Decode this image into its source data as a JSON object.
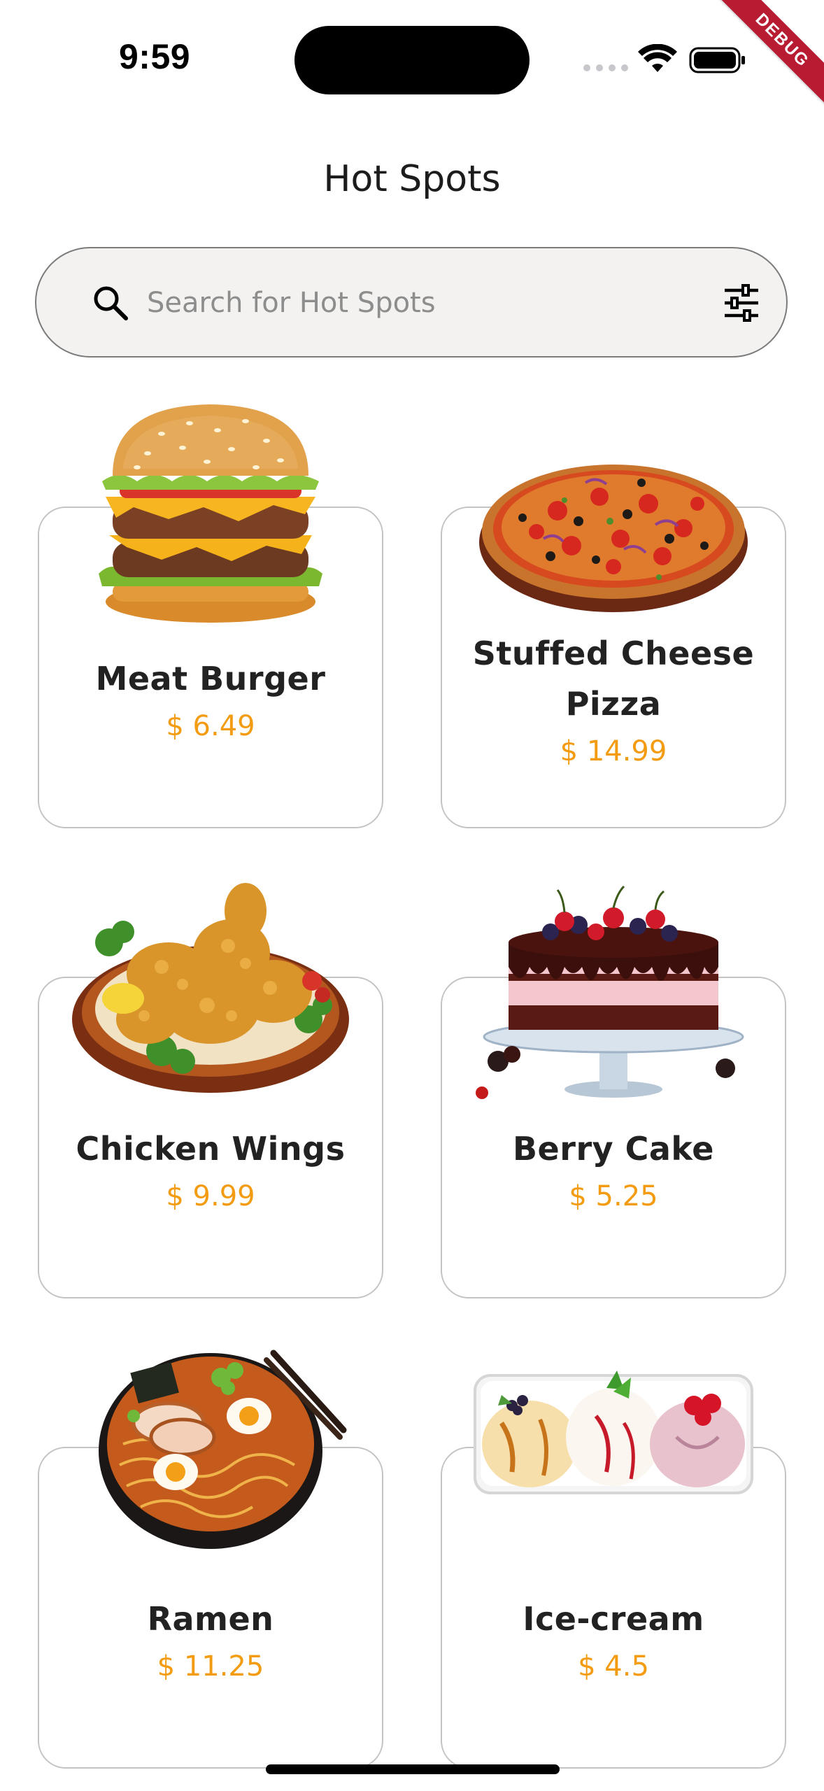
{
  "status_bar": {
    "time": "9:59",
    "debug_label": "DEBUG"
  },
  "header": {
    "title": "Hot Spots"
  },
  "search": {
    "placeholder": "Search for Hot Spots",
    "value": ""
  },
  "items": [
    {
      "name": "Meat Burger",
      "price": "$ 6.49",
      "image": "burger-image"
    },
    {
      "name": "Stuffed Cheese Pizza",
      "price": "$ 14.99",
      "image": "pizza-image"
    },
    {
      "name": "Chicken Wings",
      "price": "$ 9.99",
      "image": "chicken-wings-image"
    },
    {
      "name": "Berry Cake",
      "price": "$ 5.25",
      "image": "berry-cake-image"
    },
    {
      "name": "Ramen",
      "price": "$ 11.25",
      "image": "ramen-image"
    },
    {
      "name": "Ice-cream",
      "price": "$ 4.5",
      "image": "ice-cream-image"
    }
  ],
  "colors": {
    "accent_price": "#f39c12",
    "search_background": "#f3f2f0",
    "card_border": "#c4c4c4",
    "debug_ribbon": "#b81c32"
  }
}
